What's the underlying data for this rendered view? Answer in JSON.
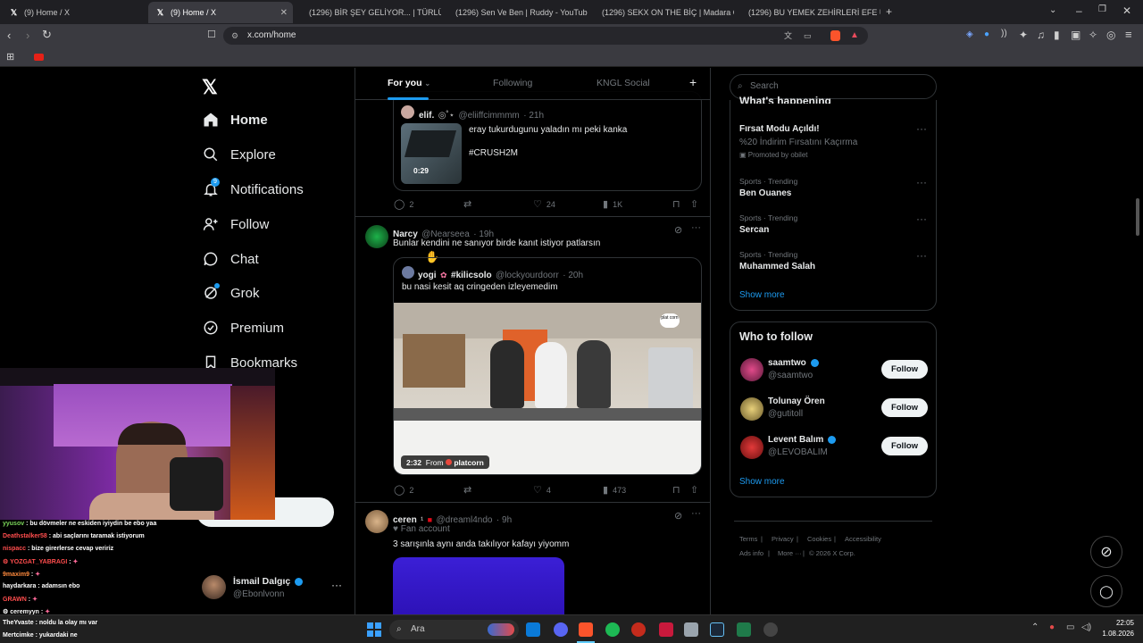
{
  "browser": {
    "tabs": [
      {
        "label": "(9) Home / X",
        "icon": "x-logo-icon",
        "active": false
      },
      {
        "label": "(9) Home / X",
        "icon": "x-logo-icon",
        "active": true
      },
      {
        "label": "(1296) BİR ŞEY GELİYOR... | TÜRLÜ M",
        "icon": "youtube-icon",
        "active": false
      },
      {
        "label": "(1296) Sen Ve Ben | Ruddy - YouTube",
        "icon": "youtube-icon",
        "active": false
      },
      {
        "label": "(1296) SEKX ON THE BİÇ | Madara O",
        "icon": "youtube-icon",
        "active": false
      },
      {
        "label": "(1296) BU YEMEK ZEHİRLERİ EFE UYG",
        "icon": "youtube-icon",
        "active": false
      }
    ],
    "url": "x.com/home"
  },
  "nav": {
    "items": [
      {
        "label": "Home",
        "icon": "home-icon"
      },
      {
        "label": "Explore",
        "icon": "search-icon"
      },
      {
        "label": "Notifications",
        "icon": "bell-icon",
        "badge": "9"
      },
      {
        "label": "Follow",
        "icon": "add-person-icon"
      },
      {
        "label": "Chat",
        "icon": "chat-icon"
      },
      {
        "label": "Grok",
        "icon": "grok-icon"
      },
      {
        "label": "Premium",
        "icon": "premium-icon"
      },
      {
        "label": "Bookmarks",
        "icon": "bookmark-icon"
      }
    ],
    "account": {
      "name": "İsmail Dalgıç",
      "handle": "@Ebonlvonn"
    }
  },
  "feed": {
    "tabs": [
      "For you",
      "Following",
      "KNGL Social"
    ],
    "tweet1": {
      "name": "elif.",
      "handle": "@eliiffcimmmm",
      "time": "· 21h",
      "text1": "eray tukurdugunu yaladın mı peki kanka",
      "text2": "#CRUSH2M",
      "video_duration": "0:29",
      "replies": "2",
      "likes": "24",
      "views": "1K"
    },
    "tweet2": {
      "name": "Narcy",
      "handle": "@Nearseea",
      "time": "· 19h",
      "text": "Bunlar kendini ne sanıyor birde kanıt istiyor patlarsın",
      "quote_name": "yogi",
      "quote_tag": "#kilicsolo",
      "quote_handle": "@lockyourdoorr",
      "quote_time": "· 20h",
      "quote_text": "bu nasi kesit aq cringeden izleyemedim",
      "video_duration": "2:32",
      "video_from": "From",
      "video_source": "platcorn",
      "watermark": "plat corn",
      "replies": "2",
      "likes": "4",
      "views": "473"
    },
    "tweet3": {
      "name": "ceren",
      "handle": "@dreaml4ndo",
      "time": "· 9h",
      "badge": "Fan account",
      "text": "3 sarışınla aynı anda takılıyor kafayı yiyomm"
    }
  },
  "sidebar": {
    "search_placeholder": "Search",
    "happening_title": "What's happening",
    "promo": {
      "title": "Fırsat Modu Açıldı!",
      "subtitle": "%20 İndirim Fırsatını Kaçırma",
      "promoted": "Promoted by obilet"
    },
    "trends": [
      {
        "category": "Sports · Trending",
        "name": "Ben Ouanes"
      },
      {
        "category": "Sports · Trending",
        "name": "Sercan"
      },
      {
        "category": "Sports · Trending",
        "name": "Muhammed Salah"
      }
    ],
    "show_more": "Show more",
    "who_to_follow_title": "Who to follow",
    "follow_label": "Follow",
    "suggestions": [
      {
        "name": "saamtwo",
        "handle": "@saamtwo",
        "verified": true
      },
      {
        "name": "Tolunay Ören",
        "handle": "@gutitoll",
        "verified": false
      },
      {
        "name": "Levent Balım",
        "handle": "@LEVOBALIM",
        "verified": true
      }
    ],
    "show_more_2": "Show more",
    "footer": [
      "Terms",
      "Privacy",
      "Cookies",
      "Accessibility",
      "Ads info",
      "More ···",
      "© 2026 X Corp."
    ]
  },
  "stream_chat": [
    {
      "user": "yyusov",
      "msg": ": bu dövmeler ne eskiden iyiydin be ebo yaa",
      "color": "#7bd65a"
    },
    {
      "user": "Deathstalker58",
      "msg": ": abi saçlarını taramak istiyorum",
      "color": "#ff4d4d"
    },
    {
      "user": "nispacc",
      "msg": ": bize girerlerse cevap veririz",
      "color": "#ff4d4d"
    },
    {
      "user": "YOZGAT_YABRAGI",
      "msg": ":",
      "color": "#ff4d4d"
    },
    {
      "user": "9maxim9",
      "msg": ":",
      "color": "#ff8a3d"
    },
    {
      "user": "haydarkara",
      "msg": ": adamsın ebo",
      "color": "#ffffff"
    },
    {
      "user": "GRAWN",
      "msg": ":",
      "color": "#ff4d4d"
    },
    {
      "user": "ceremyyn",
      "msg": ":",
      "color": "#ffffff"
    },
    {
      "user": "TheYvaste",
      "msg": ": noldu la olay mı var",
      "color": "#ffffff"
    },
    {
      "user": "Mertcimke",
      "msg": ": yukardaki ne",
      "color": "#ffffff"
    }
  ],
  "taskbar": {
    "search_label": "Ara",
    "time": "22:05",
    "date": "1.08.2026"
  },
  "colors": {
    "accent": "#1d9bf0",
    "bg": "#000000",
    "border": "#2f3336"
  }
}
